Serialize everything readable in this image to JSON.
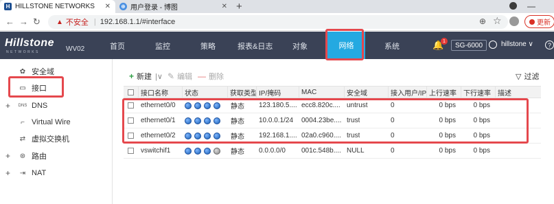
{
  "browser": {
    "tabs": [
      {
        "title": "HILLSTONE NETWORKS",
        "favicon": "H",
        "active": true
      },
      {
        "title": "用户登录 - 博图",
        "favicon": "⊕",
        "active": false
      }
    ],
    "new_tab": "+",
    "insecure_label": "不安全",
    "url": "192.168.1.1/#interface",
    "update_label": "更新"
  },
  "app": {
    "logo": "Hillstone",
    "logo_sub": "NETWORKS",
    "model": "WV02",
    "menu": [
      "首页",
      "监控",
      "策略",
      "报表&日志",
      "对象",
      "网络",
      "系统"
    ],
    "active_menu": "网络",
    "notification_count": "1",
    "device": "SG-6000",
    "username": "hillstone ∨",
    "help": "?"
  },
  "sidebar": {
    "items": [
      {
        "label": "安全域",
        "icon": "security-zone-icon",
        "expand": ""
      },
      {
        "label": "接口",
        "icon": "interface-icon",
        "expand": ""
      },
      {
        "label": "DNS",
        "icon": "dns-icon",
        "expand": "+"
      },
      {
        "label": "Virtual Wire",
        "icon": "virtual-wire-icon",
        "expand": ""
      },
      {
        "label": "虚拟交换机",
        "icon": "virtual-switch-icon",
        "expand": ""
      },
      {
        "label": "路由",
        "icon": "route-icon",
        "expand": "+"
      },
      {
        "label": "NAT",
        "icon": "nat-icon",
        "expand": "+"
      }
    ]
  },
  "toolbar": {
    "new_label": "新建",
    "edit_label": "编辑",
    "delete_label": "删除",
    "filter_label": "过滤"
  },
  "table": {
    "columns": [
      "接口名称",
      "状态",
      "获取类型",
      "IP/掩码",
      "MAC",
      "安全域",
      "接入用户/IP",
      "上行速率",
      "下行速率",
      "描述"
    ],
    "rows": [
      {
        "name": "ethernet0/0",
        "status": [
          "up",
          "up",
          "up",
          "up"
        ],
        "type": "静态",
        "ip": "123.180.5....",
        "mac": "ecc8.820c....",
        "zone": "untrust",
        "users": "0",
        "up": "0 bps",
        "down": "0 bps",
        "desc": ""
      },
      {
        "name": "ethernet0/1",
        "status": [
          "up",
          "up",
          "up",
          "up"
        ],
        "type": "静态",
        "ip": "10.0.0.1/24",
        "mac": "0004.23be....",
        "zone": "trust",
        "users": "0",
        "up": "0 bps",
        "down": "0 bps",
        "desc": ""
      },
      {
        "name": "ethernet0/2",
        "status": [
          "up",
          "up",
          "up",
          "up"
        ],
        "type": "静态",
        "ip": "192.168.1....",
        "mac": "02a0.c960....",
        "zone": "trust",
        "users": "0",
        "up": "0 bps",
        "down": "0 bps",
        "desc": ""
      },
      {
        "name": "vswitchif1",
        "status": [
          "up",
          "up",
          "up",
          "down"
        ],
        "type": "静态",
        "ip": "0.0.0.0/0",
        "mac": "001c.548b....",
        "zone": "NULL",
        "users": "0",
        "up": "0 bps",
        "down": "0 bps",
        "desc": ""
      }
    ]
  },
  "colors": {
    "header_bg": "#3a4256",
    "accent": "#24a9e1",
    "highlight": "#e5484d"
  }
}
